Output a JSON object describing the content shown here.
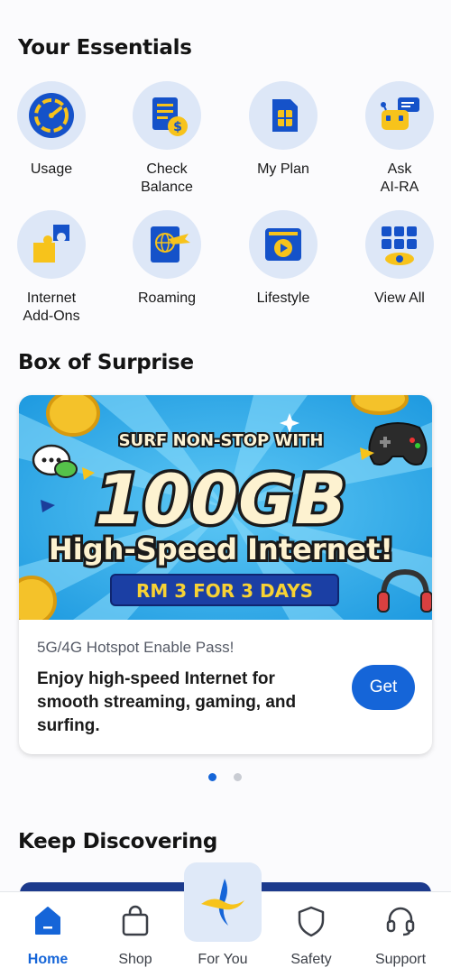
{
  "essentials": {
    "title": "Your Essentials",
    "items": [
      {
        "label": "Usage",
        "icon": "gauge-icon"
      },
      {
        "label": "Check\nBalance",
        "icon": "balance-icon"
      },
      {
        "label": "My Plan",
        "icon": "sim-icon"
      },
      {
        "label": "Ask\nAI-RA",
        "icon": "robot-chat-icon"
      },
      {
        "label": "Internet\nAdd-Ons",
        "icon": "puzzle-icon"
      },
      {
        "label": "Roaming",
        "icon": "passport-icon"
      },
      {
        "label": "Lifestyle",
        "icon": "play-icon"
      },
      {
        "label": "View All",
        "icon": "grid-eye-icon"
      }
    ]
  },
  "surprise": {
    "title": "Box of Surprise",
    "banner": {
      "headline_top": "SURF NON-STOP WITH",
      "headline_big": "100GB",
      "headline_mid": "High-Speed Internet!",
      "price_pill": "RM 3 FOR 3 DAYS"
    },
    "subtitle": "5G/4G Hotspot Enable Pass!",
    "description": "Enjoy high-speed Internet for smooth streaming, gaming, and surfing.",
    "cta": "Get",
    "carousel": {
      "count": 2,
      "active": 1
    }
  },
  "discover": {
    "title": "Keep Discovering"
  },
  "nav": {
    "items": [
      {
        "label": "Home",
        "icon": "home-icon",
        "active": true
      },
      {
        "label": "Shop",
        "icon": "shopping-bag-icon",
        "active": false
      },
      {
        "label": "For You",
        "icon": "sparkle-logo-icon",
        "active": false
      },
      {
        "label": "Safety",
        "icon": "shield-icon",
        "active": false
      },
      {
        "label": "Support",
        "icon": "headset-icon",
        "active": false
      }
    ]
  },
  "colors": {
    "accent": "#1565d8",
    "icon_yellow": "#f7c31b",
    "icon_blue": "#1552c9",
    "circle_bg": "#dde7f7"
  }
}
